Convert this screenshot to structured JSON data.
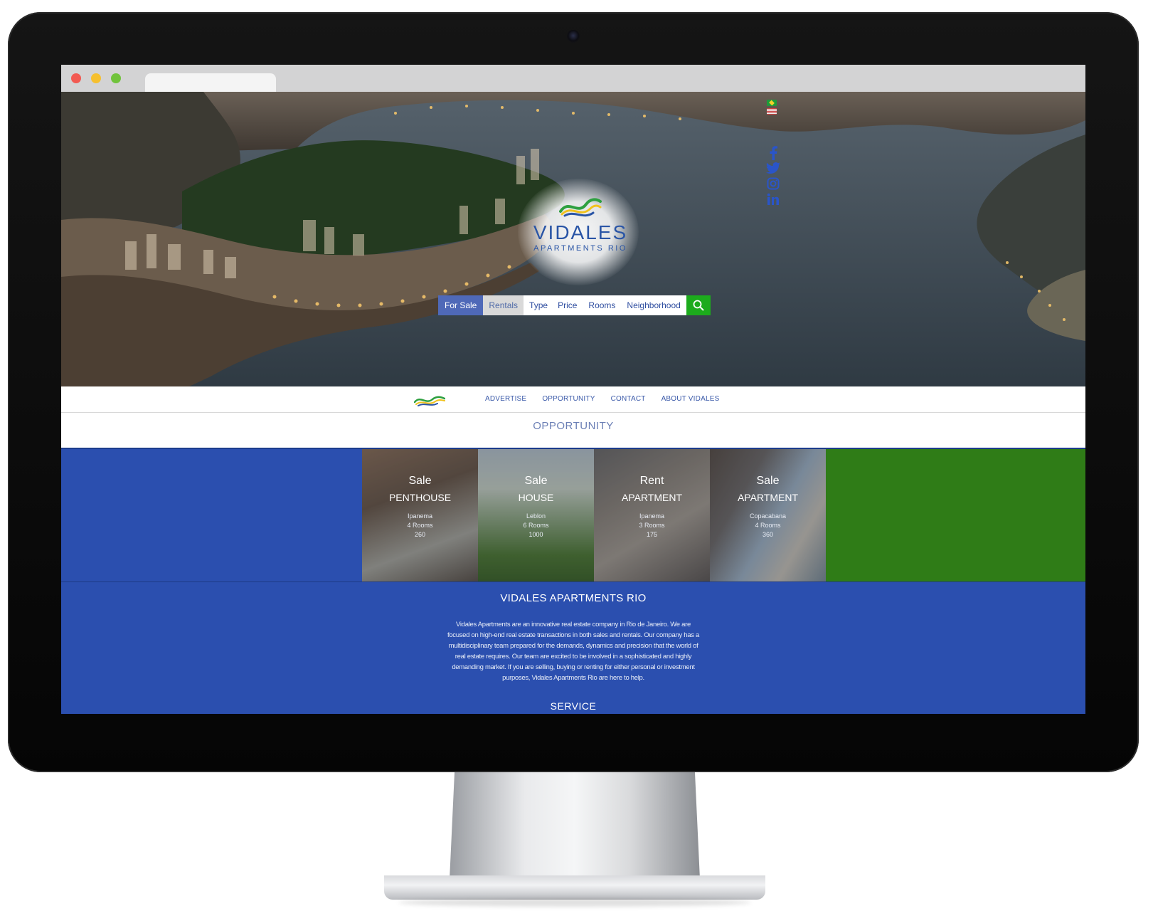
{
  "browser": {
    "traffic_lights": [
      "red",
      "yellow",
      "green"
    ]
  },
  "hero": {
    "logo_title": "VIDALES",
    "logo_subtitle": "APARTMENTS RIO",
    "social_icons": [
      "facebook-icon",
      "twitter-icon",
      "instagram-icon",
      "linkedin-icon"
    ],
    "language_flags": [
      "brazil-flag",
      "us-flag"
    ],
    "search": {
      "for_sale": "For Sale",
      "rentals": "Rentals",
      "type": "Type",
      "price": "Price",
      "rooms": "Rooms",
      "neighborhood": "Neighborhood",
      "go_icon": "search-icon"
    }
  },
  "nav": {
    "links": [
      "ADVERTISE",
      "OPPORTUNITY",
      "CONTACT",
      "ABOUT VIDALES"
    ]
  },
  "opportunity": {
    "heading": "OPPORTUNITY",
    "listings": [
      {
        "deal": "Sale",
        "kind": "PENTHOUSE",
        "neighborhood": "Ipanema",
        "rooms": "4 Rooms",
        "area": "260"
      },
      {
        "deal": "Sale",
        "kind": "HOUSE",
        "neighborhood": "Leblon",
        "rooms": "6 Rooms",
        "area": "1000"
      },
      {
        "deal": "Rent",
        "kind": "APARTMENT",
        "neighborhood": "Ipanema",
        "rooms": "3 Rooms",
        "area": "175"
      },
      {
        "deal": "Sale",
        "kind": "APARTMENT",
        "neighborhood": "Copacabana",
        "rooms": "4 Rooms",
        "area": "360"
      }
    ]
  },
  "about": {
    "title": "VIDALES APARTMENTS RIO",
    "text": "Vidales Apartments are an innovative real estate company in Rio de Janeiro. We are focused on high-end real estate transactions in both sales and rentals. Our company has a multidisciplinary team prepared for the demands, dynamics and precision that the world of real estate requires. Our team are excited to be involved in a sophisticated and highly demanding market. If you are selling, buying or renting for either personal or investment purposes, Vidales Apartments Rio are here to help.",
    "service_title": "SERVICE"
  },
  "colors": {
    "brand_blue": "#2b4faf",
    "brand_green": "#2f7c17",
    "search_green": "#1cab1c",
    "logo_blue": "#2a55a6"
  }
}
